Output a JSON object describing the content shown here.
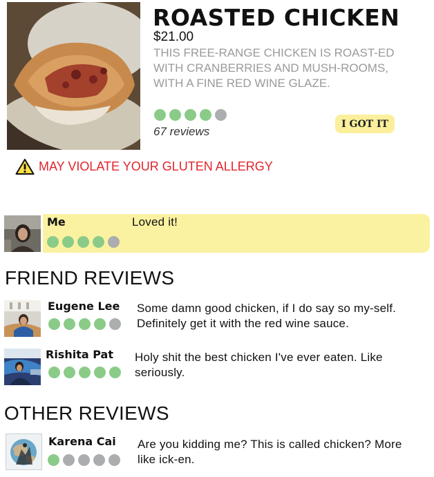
{
  "dish": {
    "title": "ROASTED CHICKEN",
    "price": "$21.00",
    "description": "THIS FREE-RANGE CHICKEN IS ROAST-ED WITH CRANBERRIES AND MUSH-ROOMS, WITH A FINE RED WINE GLAZE.",
    "rating": 4,
    "rating_max": 5,
    "reviews_count": "67 reviews",
    "got_it_label": "I GOT IT",
    "warning": "MAY VIOLATE YOUR GLUTEN ALLERGY"
  },
  "my_review": {
    "name": "Me",
    "text": "Loved it!",
    "rating": 4,
    "rating_max": 5
  },
  "sections": {
    "friend_heading": "FRIEND REVIEWS",
    "other_heading": "OTHER REVIEWS"
  },
  "friend_reviews": [
    {
      "name": "Eugene Lee",
      "text": "Some damn good chicken, if I do say so my-self. Definitely get it with the red wine sauce.",
      "rating": 4,
      "rating_max": 5
    },
    {
      "name": "Rishita Pat",
      "text": "Holy shit the best chicken I've ever eaten. Like seriously.",
      "rating": 5,
      "rating_max": 5
    }
  ],
  "other_reviews": [
    {
      "name": "Karena Cai",
      "text": "Are you kidding me? This is called chicken? More like ick-en.",
      "rating": 1,
      "rating_max": 5
    }
  ],
  "colors": {
    "dot_on": "#8acb88",
    "dot_off": "#abadae",
    "highlight": "#fbf2a1",
    "button": "#fbef9c",
    "warning": "#e0242b"
  },
  "icons": {
    "warning": "warning-triangle-icon"
  }
}
